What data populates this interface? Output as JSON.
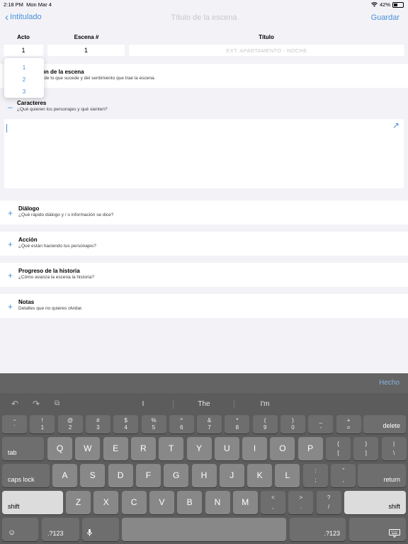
{
  "status": {
    "time": "2:18 PM",
    "date": "Mon Mar 4",
    "battery": "42%",
    "wifi_icon": "wifi-icon"
  },
  "nav": {
    "back_label": "Intitulado",
    "title": "Título de la escena",
    "save_label": "Guardar"
  },
  "fields": {
    "act_header": "Acto",
    "scene_header": "Escena #",
    "title_header": "Título",
    "act_value": "1",
    "scene_value": "1",
    "title_placeholder": "EXT. APARTAMENTO - NOCHE"
  },
  "picker": {
    "options": [
      "1",
      "2",
      "3"
    ]
  },
  "sections": {
    "description": {
      "title": "ón de la escena",
      "subtitle": "l de lo que sucede y del sentimiento que trae la escena."
    },
    "characters": {
      "icon": "minus-icon",
      "title": "Caracteres",
      "subtitle": "¿Qué quieren los personajes y qué sienten?"
    },
    "dialogue": {
      "icon": "plus-icon",
      "title": "Diálogo",
      "subtitle": "¿Qué rápido diálogo y / o información se dice?"
    },
    "action": {
      "icon": "plus-icon",
      "title": "Acción",
      "subtitle": "¿Qué están haciendo tus personajes?"
    },
    "progress": {
      "icon": "plus-icon",
      "title": "Progreso de la historia",
      "subtitle": "¿Cómo avanza la escena la historia?"
    },
    "notes": {
      "icon": "plus-icon",
      "title": "Notas",
      "subtitle": "Detalles que no quieres olvidar."
    }
  },
  "keyboard": {
    "done_label": "Hecho",
    "suggestions": [
      "I",
      "The",
      "I'm"
    ],
    "row1": [
      {
        "top": "~",
        "bot": "`"
      },
      {
        "top": "!",
        "bot": "1"
      },
      {
        "top": "@",
        "bot": "2"
      },
      {
        "top": "#",
        "bot": "3"
      },
      {
        "top": "$",
        "bot": "4"
      },
      {
        "top": "%",
        "bot": "5"
      },
      {
        "top": "^",
        "bot": "6"
      },
      {
        "top": "&",
        "bot": "7"
      },
      {
        "top": "*",
        "bot": "8"
      },
      {
        "top": "(",
        "bot": "9"
      },
      {
        "top": ")",
        "bot": "0"
      },
      {
        "top": "_",
        "bot": "-"
      },
      {
        "top": "+",
        "bot": "="
      }
    ],
    "delete_label": "delete",
    "tab_label": "tab",
    "row2": [
      "Q",
      "W",
      "E",
      "R",
      "T",
      "Y",
      "U",
      "I",
      "O",
      "P"
    ],
    "row2_extra": [
      {
        "top": "{",
        "bot": "["
      },
      {
        "top": "}",
        "bot": "]"
      },
      {
        "top": "|",
        "bot": "\\"
      }
    ],
    "caps_label": "caps lock",
    "row3": [
      "A",
      "S",
      "D",
      "F",
      "G",
      "H",
      "J",
      "K",
      "L"
    ],
    "row3_extra": [
      {
        "top": ":",
        "bot": ";"
      },
      {
        "top": "\"",
        "bot": ","
      }
    ],
    "return_label": "return",
    "shift_label": "shift",
    "row4": [
      "Z",
      "X",
      "C",
      "V",
      "B",
      "N",
      "M"
    ],
    "row4_extra": [
      {
        "top": "<",
        "bot": ","
      },
      {
        "top": ">",
        "bot": "."
      },
      {
        "top": "?",
        "bot": "/"
      }
    ],
    "num_label": ".?123"
  }
}
